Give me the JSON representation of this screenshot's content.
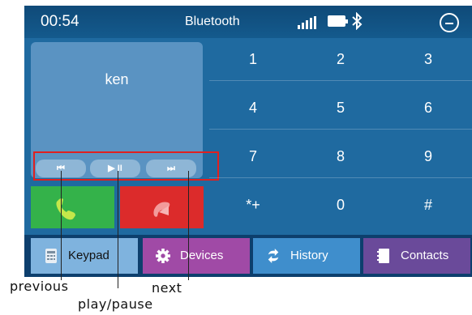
{
  "status_bar": {
    "time": "00:54",
    "title": "Bluetooth"
  },
  "contact": {
    "name": "ken"
  },
  "media": {
    "previous": "⏮",
    "play_pause": "▶ II",
    "next": "⏭"
  },
  "keypad": [
    "1",
    "2",
    "3",
    "4",
    "5",
    "6",
    "7",
    "8",
    "9",
    "*+",
    "0",
    "#"
  ],
  "nav": {
    "keypad": "Keypad",
    "devices": "Devices",
    "history": "History",
    "contacts": "Contacts"
  },
  "callouts": {
    "previous": "previous",
    "play_pause": "play/pause",
    "next": "next"
  },
  "colors": {
    "screen_bg": "#1f6aa0",
    "accept": "#34b24a",
    "reject": "#dc2b2b",
    "highlight": "#e02020"
  },
  "icons": {
    "status": [
      "signal-icon",
      "battery-icon",
      "bluetooth-icon",
      "minimize-icon"
    ],
    "call": [
      "phone-answer-icon",
      "phone-hangup-icon"
    ],
    "nav": [
      "keypad-icon",
      "gear-icon",
      "sync-icon",
      "contacts-book-icon"
    ]
  }
}
